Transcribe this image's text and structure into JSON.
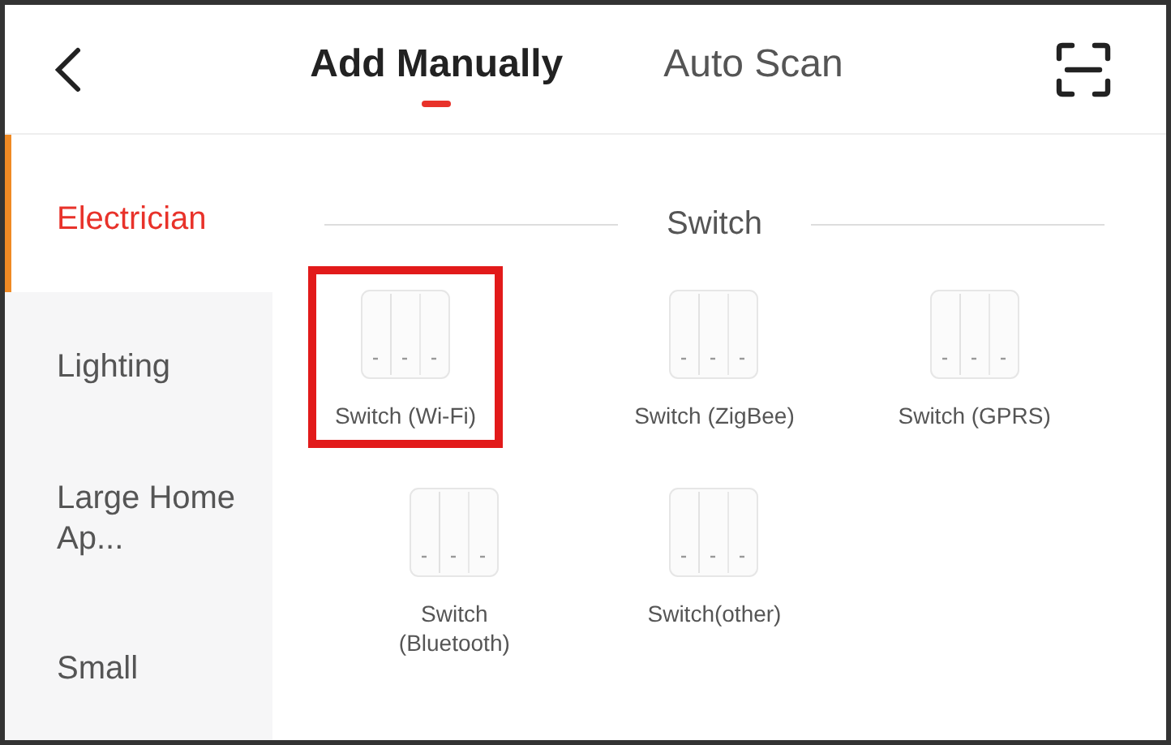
{
  "tabs": [
    {
      "label": "Add Manually",
      "selected": true
    },
    {
      "label": "Auto Scan",
      "selected": false
    }
  ],
  "sidebar": {
    "items": [
      {
        "label": "Electrician",
        "selected": true
      },
      {
        "label": "Lighting",
        "selected": false
      },
      {
        "label": "Large Home Ap...",
        "selected": false
      },
      {
        "label": "Small",
        "selected": false
      }
    ]
  },
  "section": {
    "title": "Switch",
    "devices": [
      {
        "label": "Switch (Wi-Fi)",
        "highlighted": true
      },
      {
        "label": "Switch (ZigBee)",
        "highlighted": false
      },
      {
        "label": "Switch (GPRS)",
        "highlighted": false
      },
      {
        "label": "Switch (Bluetooth)",
        "highlighted": false
      },
      {
        "label": "Switch(other)",
        "highlighted": false
      }
    ]
  }
}
